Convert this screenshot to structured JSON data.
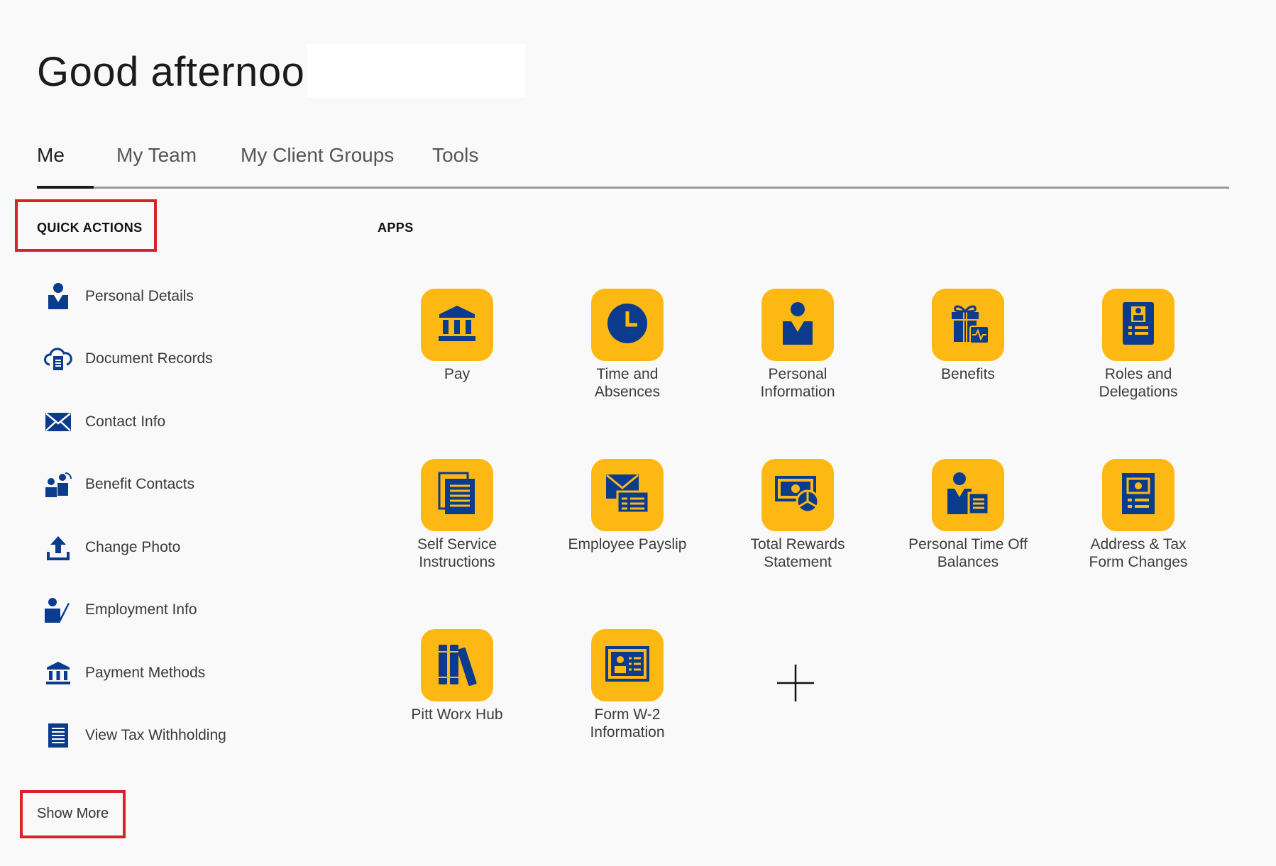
{
  "header": {
    "greeting": "Good afternoon,"
  },
  "tabs": [
    {
      "label": "Me",
      "active": true
    },
    {
      "label": "My Team"
    },
    {
      "label": "My Client Groups"
    },
    {
      "label": "Tools"
    }
  ],
  "quick_actions": {
    "title": "QUICK ACTIONS",
    "items": [
      {
        "label": "Personal Details",
        "icon": "person-icon"
      },
      {
        "label": "Document Records",
        "icon": "cloud-document-icon"
      },
      {
        "label": "Contact Info",
        "icon": "envelope-icon"
      },
      {
        "label": "Benefit Contacts",
        "icon": "people-icon"
      },
      {
        "label": "Change Photo",
        "icon": "upload-icon"
      },
      {
        "label": "Employment Info",
        "icon": "person-edit-icon"
      },
      {
        "label": "Payment Methods",
        "icon": "bank-icon"
      },
      {
        "label": "View Tax Withholding",
        "icon": "list-document-icon"
      }
    ],
    "show_more": "Show More"
  },
  "apps": {
    "title": "APPS",
    "items": [
      {
        "label": "Pay",
        "icon": "bank-icon"
      },
      {
        "label": "Time and\nAbsences",
        "icon": "clock-icon"
      },
      {
        "label": "Personal\nInformation",
        "icon": "person-icon"
      },
      {
        "label": "Benefits",
        "icon": "gift-icon"
      },
      {
        "label": "Roles and\nDelegations",
        "icon": "badge-icon"
      },
      {
        "label": "Self Service\nInstructions",
        "icon": "documents-icon"
      },
      {
        "label": "Employee Payslip",
        "icon": "payslip-icon"
      },
      {
        "label": "Total Rewards\nStatement",
        "icon": "money-chart-icon"
      },
      {
        "label": "Personal Time Off\nBalances",
        "icon": "person-document-icon"
      },
      {
        "label": "Address & Tax\nForm Changes",
        "icon": "form-icon"
      },
      {
        "label": "Pitt Worx Hub",
        "icon": "books-icon"
      },
      {
        "label": "Form W-2\nInformation",
        "icon": "id-card-icon"
      }
    ],
    "add_icon": "plus-icon"
  },
  "colors": {
    "tile": "#fdb813",
    "icon": "#0a3b8c",
    "highlight": "#d8232a"
  }
}
